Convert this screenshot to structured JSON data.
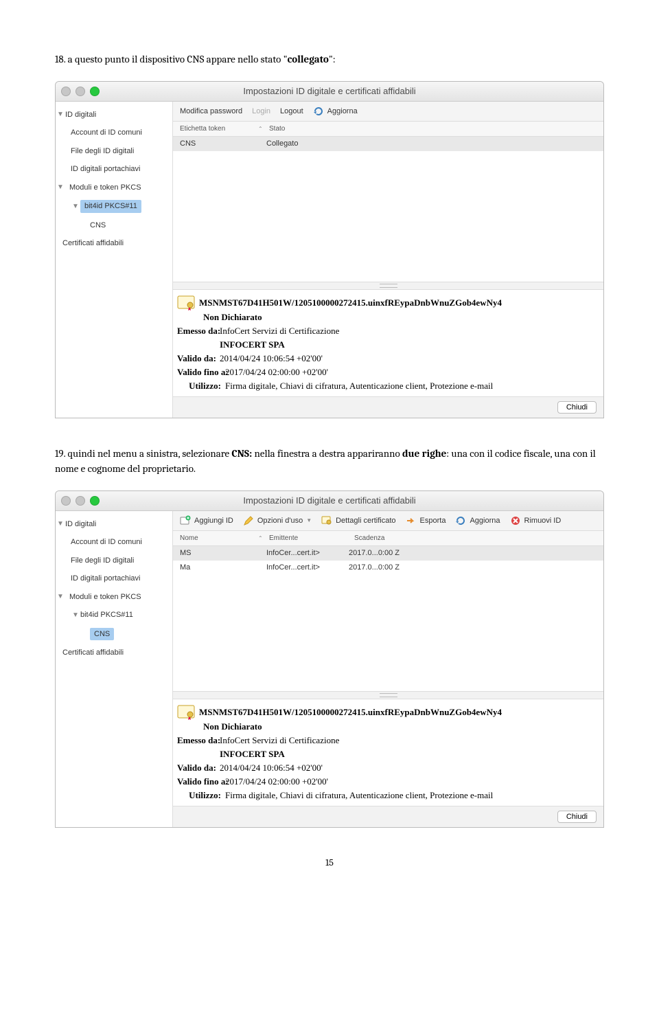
{
  "doc": {
    "line1_prefix": "18. a questo punto il dispositivo CNS appare nello stato \"",
    "line1_bold": "collegato",
    "line1_suffix": "\":",
    "line2_a": "19. quindi nel menu a sinistra, selezionare ",
    "line2_b": "CNS:",
    "line2_c": " nella finestra a destra appariranno ",
    "line2_d": "due righe",
    "line2_e": ": una con il codice fiscale, una con il nome e cognome del proprietario.",
    "pagenum": "15"
  },
  "dialog": {
    "title": "Impostazioni ID digitale e certificati affidabili",
    "chiudi": "Chiudi"
  },
  "sidebar": {
    "id_digitali": "ID digitali",
    "account": "Account di ID comuni",
    "file": "File degli ID digitali",
    "portachiavi": "ID digitali portachiavi",
    "moduli": "Moduli e token PKCS",
    "bit4id": "bit4id PKCS#11",
    "cns": "CNS",
    "cert_affidabili": "Certificati affidabili"
  },
  "toolbar1": {
    "modpass": "Modifica password",
    "login": "Login",
    "logout": "Logout",
    "aggiorna": "Aggiorna"
  },
  "toolbar2": {
    "aggiungi": "Aggiungi ID",
    "opzioni": "Opzioni d'uso",
    "dettagli": "Dettagli certificato",
    "esporta": "Esporta",
    "aggiorna": "Aggiorna",
    "rimuovi": "Rimuovi ID"
  },
  "table1": {
    "h1": "Etichetta token",
    "h2": "Stato",
    "r1c1": "CNS",
    "r1c2": "Collegato"
  },
  "table2": {
    "h1": "Nome",
    "h2": "Emittente",
    "h3": "Scadenza",
    "r1c1": "MS",
    "r1c2": "InfoCer...cert.it>",
    "r1c3": "2017.0...0:00 Z",
    "r2c1": "Ma",
    "r2c2": "InfoCer...cert.it>",
    "r2c3": "2017.0...0:00 Z"
  },
  "cert": {
    "cn": "MSNMST67D41H501W/1205100000272415.uinxfREypaDnbWnuZGob4ewNy4",
    "non_dich": "Non Dichiarato",
    "emesso_da_k": "Emesso da:",
    "emesso_da_v1": "InfoCert Servizi di Certificazione",
    "emesso_da_v2": "INFOCERT SPA",
    "valido_da_k": "Valido da:",
    "valido_da_v": "2014/04/24 10:06:54 +02'00'",
    "valido_fino_k": "Valido fino a:",
    "valido_fino_v": "2017/04/24 02:00:00 +02'00'",
    "utilizzo_k": "Utilizzo:",
    "utilizzo_v": "Firma digitale, Chiavi di cifratura, Autenticazione client, Protezione e-mail"
  }
}
